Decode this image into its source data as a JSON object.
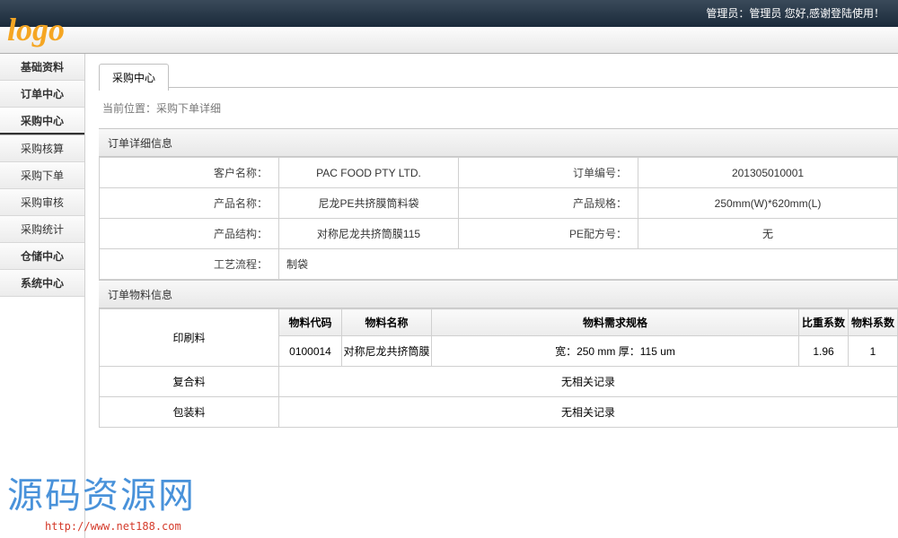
{
  "header": {
    "admin_text": "管理员：管理员 您好,感谢登陆使用！",
    "logo": "logo"
  },
  "sidebar": {
    "items": [
      {
        "label": "基础资料",
        "primary": true
      },
      {
        "label": "订单中心",
        "primary": true
      },
      {
        "label": "采购中心",
        "primary": true,
        "active": true
      },
      {
        "label": "采购核算"
      },
      {
        "label": "采购下单"
      },
      {
        "label": "采购审核"
      },
      {
        "label": "采购统计"
      },
      {
        "label": "仓储中心",
        "primary": true
      },
      {
        "label": "系统中心",
        "primary": true
      }
    ]
  },
  "content": {
    "tab": "采购中心",
    "breadcrumb": "当前位置：采购下单详细",
    "section1_title": "订单详细信息",
    "section2_title": "订单物料信息",
    "detail": {
      "customer_lbl": "客户名称：",
      "customer_val": "PAC FOOD PTY LTD.",
      "orderno_lbl": "订单编号：",
      "orderno_val": "201305010001",
      "prodname_lbl": "产品名称：",
      "prodname_val": "尼龙PE共挤膜筒料袋",
      "prodspec_lbl": "产品规格：",
      "prodspec_val": "250mm(W)*620mm(L)",
      "prodstruct_lbl": "产品结构：",
      "prodstruct_val": "对称尼龙共挤筒膜115",
      "pe_lbl": "PE配方号：",
      "pe_val": "无",
      "process_lbl": "工艺流程：",
      "process_val": "制袋"
    },
    "mat_headers": {
      "rowhead": "印刷料",
      "code": "物料代码",
      "name": "物料名称",
      "spec": "物料需求规格",
      "ratio": "比重系数",
      "coef": "物料系数"
    },
    "mat_row": {
      "code": "0100014",
      "name": "对称尼龙共挤筒膜",
      "spec": "宽：250 mm 厚：115 um",
      "ratio": "1.96",
      "coef": "1"
    },
    "mat_compound_lbl": "复合料",
    "mat_pack_lbl": "包装料",
    "no_record": "无相关记录"
  },
  "watermark": {
    "text": "源码资源网",
    "url": "http://www.net188.com"
  }
}
